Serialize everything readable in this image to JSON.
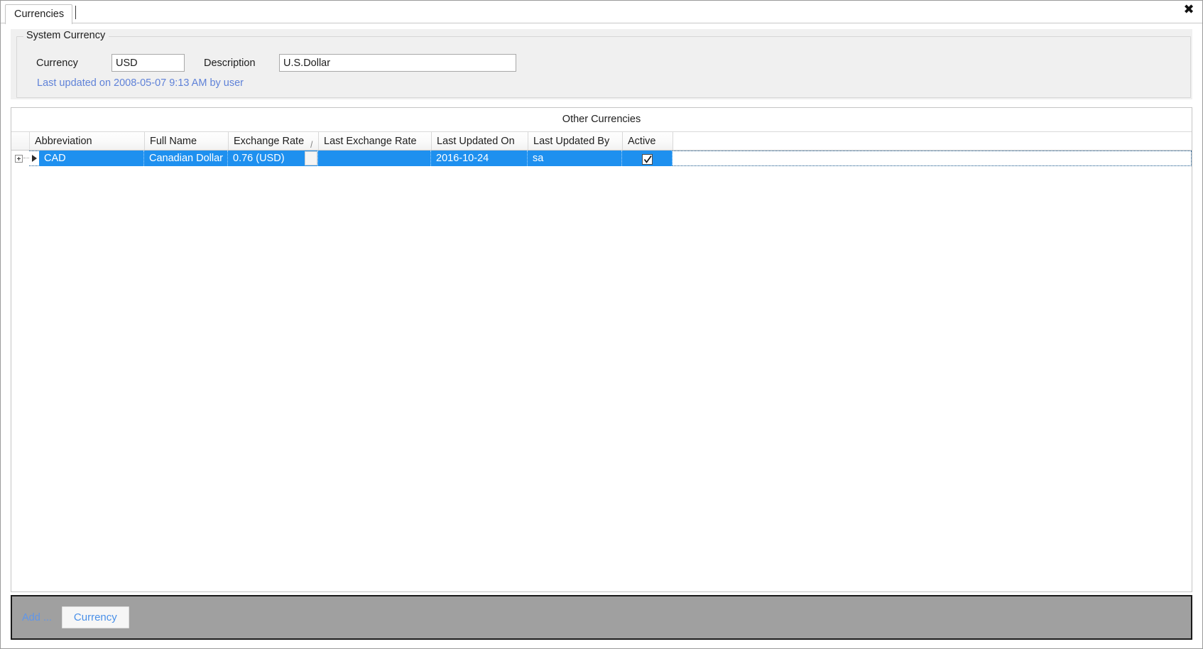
{
  "window": {
    "close_icon": "close-icon",
    "close_glyph": "✖"
  },
  "tabs": [
    {
      "label": "Currencies",
      "active": true
    }
  ],
  "system_currency": {
    "legend": "System Currency",
    "currency_label": "Currency",
    "currency_value": "USD",
    "currency_placeholder": "",
    "description_label": "Description",
    "description_value": "U.S.Dollar",
    "description_placeholder": "",
    "last_updated": "Last updated on 2008-05-07 9:13 AM by user",
    "link_color": "#5f82d8"
  },
  "other_currencies": {
    "title": "Other Currencies",
    "columns": [
      {
        "label": "Abbreviation",
        "sort": ""
      },
      {
        "label": "Full Name",
        "sort": ""
      },
      {
        "label": "Exchange Rate",
        "sort": "/"
      },
      {
        "label": "Last Exchange Rate",
        "sort": ""
      },
      {
        "label": "Last Updated On",
        "sort": ""
      },
      {
        "label": "Last Updated By",
        "sort": ""
      },
      {
        "label": "Active",
        "sort": ""
      }
    ],
    "rows": [
      {
        "expand_icon": "expand-plus-icon",
        "marker_icon": "row-pointer-icon",
        "abbreviation": "CAD",
        "full_name": "Canadian Dollar",
        "exchange_rate": "0.76 (USD)",
        "last_exchange_rate": "",
        "last_updated_on": "2016-10-24",
        "last_updated_by": "sa",
        "active": true,
        "selected": true
      }
    ],
    "selection_color": "#1e90ef"
  },
  "bottom_bar": {
    "add_label": "Add ...",
    "add_currency_button": "Currency",
    "background": "#a0a0a0",
    "button_text_color": "#4a90e8"
  }
}
